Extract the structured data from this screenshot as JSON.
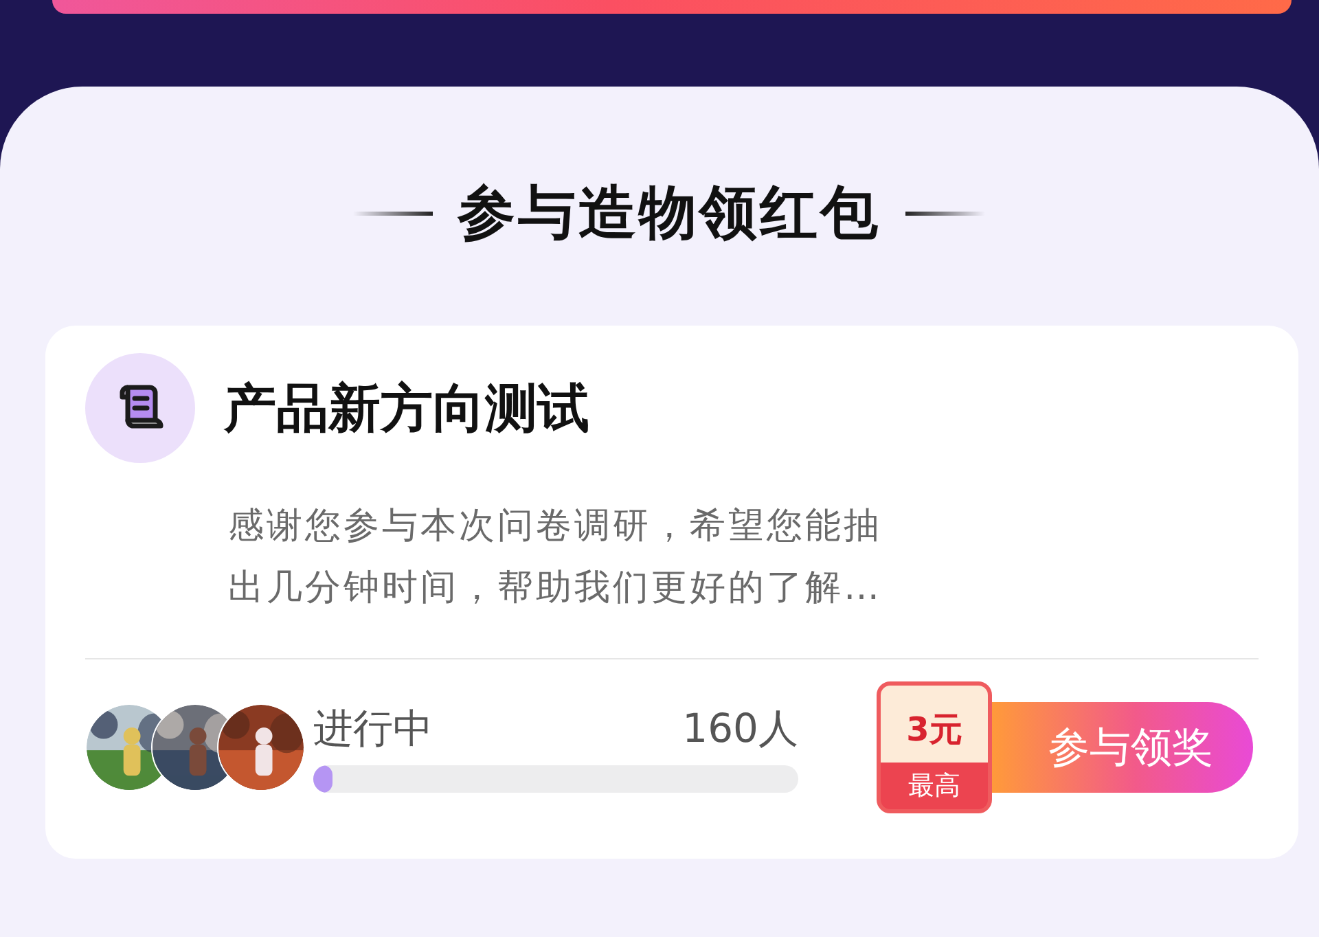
{
  "section_title": "参与造物领红包",
  "task": {
    "title": "产品新方向测试",
    "description": "感谢您参与本次问卷调研，希望您能抽出几分钟时间，帮助我们更好的了解…",
    "status": "进行中",
    "count": "160人",
    "progress": {
      "level": 0.04
    },
    "reward": {
      "amount": "3元",
      "note": "最高"
    },
    "button": "参与领奖"
  }
}
